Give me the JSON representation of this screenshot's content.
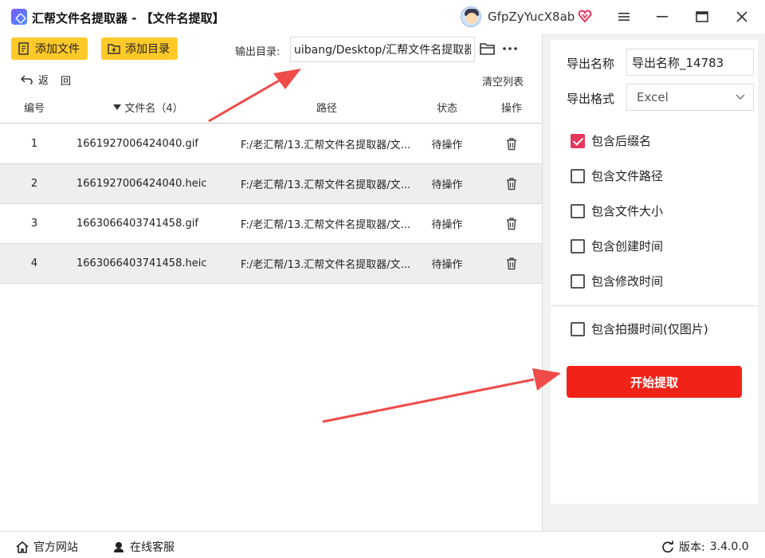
{
  "app": {
    "title": "汇帮文件名提取器 - 【文件名提取】",
    "user_name": "GfpZyYucX8ab"
  },
  "toolbar": {
    "add_file_label": "添加文件",
    "add_dir_label": "添加目录",
    "output_label": "输出目录:",
    "output_value": "uibang/Desktop/汇帮文件名提取器",
    "back_label": "返",
    "back_label2": "回",
    "clear_list_label": "清空列表"
  },
  "table": {
    "headers": [
      "编号",
      "文件名（4）",
      "路径",
      "状态",
      "操作"
    ],
    "rows": [
      {
        "index": "1",
        "name": "1661927006424040.gif",
        "path": "F:/老汇帮/13.汇帮文件名提取器/文...",
        "status": "待操作"
      },
      {
        "index": "2",
        "name": "1661927006424040.heic",
        "path": "F:/老汇帮/13.汇帮文件名提取器/文...",
        "status": "待操作"
      },
      {
        "index": "3",
        "name": "1663066403741458.gif",
        "path": "F:/老汇帮/13.汇帮文件名提取器/文...",
        "status": "待操作"
      },
      {
        "index": "4",
        "name": "1663066403741458.heic",
        "path": "F:/老汇帮/13.汇帮文件名提取器/文...",
        "status": "待操作"
      }
    ]
  },
  "settings": {
    "export_name_label": "导出名称",
    "export_name_value": "导出名称_14783",
    "export_format_label": "导出格式",
    "export_format_value": "Excel",
    "options": [
      {
        "label": "包含后缀名",
        "checked": true
      },
      {
        "label": "包含文件路径",
        "checked": false
      },
      {
        "label": "包含文件大小",
        "checked": false
      },
      {
        "label": "包含创建时间",
        "checked": false
      },
      {
        "label": "包含修改时间",
        "checked": false
      }
    ],
    "photo_option_label": "包含拍摄时间(仅图片)",
    "start_label": "开始提取"
  },
  "footer": {
    "website_label": "官方网站",
    "support_label": "在线客服",
    "version_label": "版本:",
    "version_value": "3.4.0.0"
  },
  "colors": {
    "accent_yellow": "#ffc929",
    "start_red": "#f12319",
    "check_pink": "#e8365d",
    "arrow_red": "#ef4b4b"
  }
}
